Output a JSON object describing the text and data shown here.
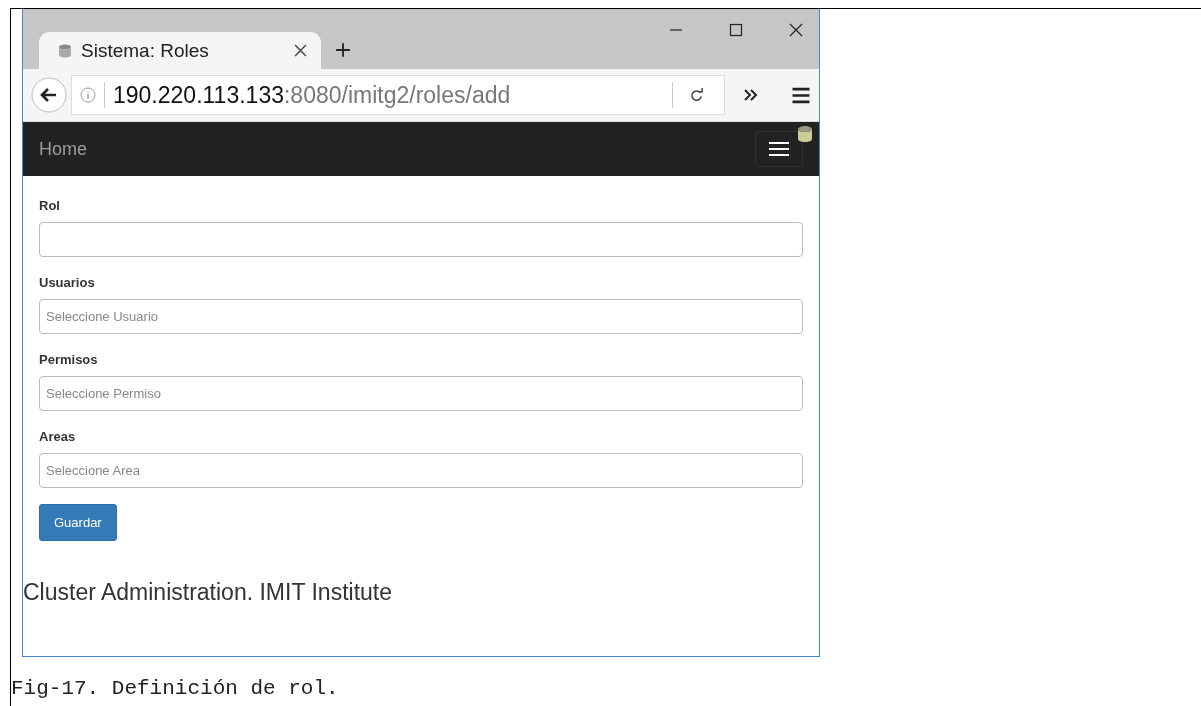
{
  "browser": {
    "tab": {
      "title": "Sistema: Roles",
      "selected": true
    },
    "address": {
      "host": "190.220.113.133",
      "path": ":8080/imitg2/roles/add"
    }
  },
  "navbar": {
    "brand": "Home"
  },
  "form": {
    "fields": [
      {
        "label": "Rol"
      },
      {
        "label": "Usuarios",
        "placeholder": "Seleccione Usuario"
      },
      {
        "label": "Permisos",
        "placeholder": "Seleccione Permiso"
      },
      {
        "label": "Areas",
        "placeholder": "Seleccione Area"
      }
    ],
    "submit": "Guardar"
  },
  "footer": "Cluster Administration. IMIT Institute",
  "caption": "Fig-17. Definición de rol."
}
